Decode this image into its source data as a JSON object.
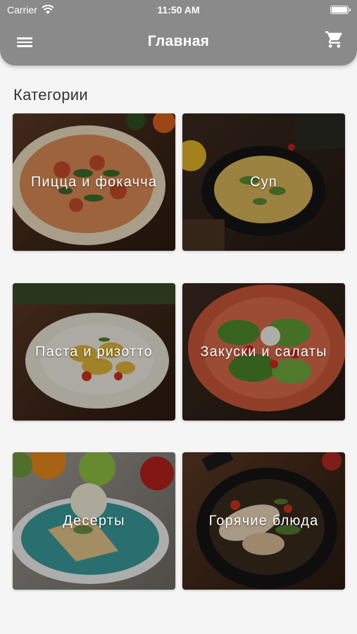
{
  "status_bar": {
    "carrier": "Carrier",
    "time": "11:50 AM"
  },
  "header": {
    "title": "Главная",
    "menu_icon": "hamburger-menu-icon",
    "cart_icon": "shopping-cart-icon"
  },
  "section": {
    "title": "Категории"
  },
  "categories": [
    {
      "label": "Пицца и фокачча"
    },
    {
      "label": "Суп"
    },
    {
      "label": "Паста и ризотто"
    },
    {
      "label": "Закуски и салаты"
    },
    {
      "label": "Десерты"
    },
    {
      "label": "Горячие блюда"
    }
  ],
  "colors": {
    "header": "#8a8a8a",
    "background": "#f5f5f5",
    "text": "#333333"
  }
}
